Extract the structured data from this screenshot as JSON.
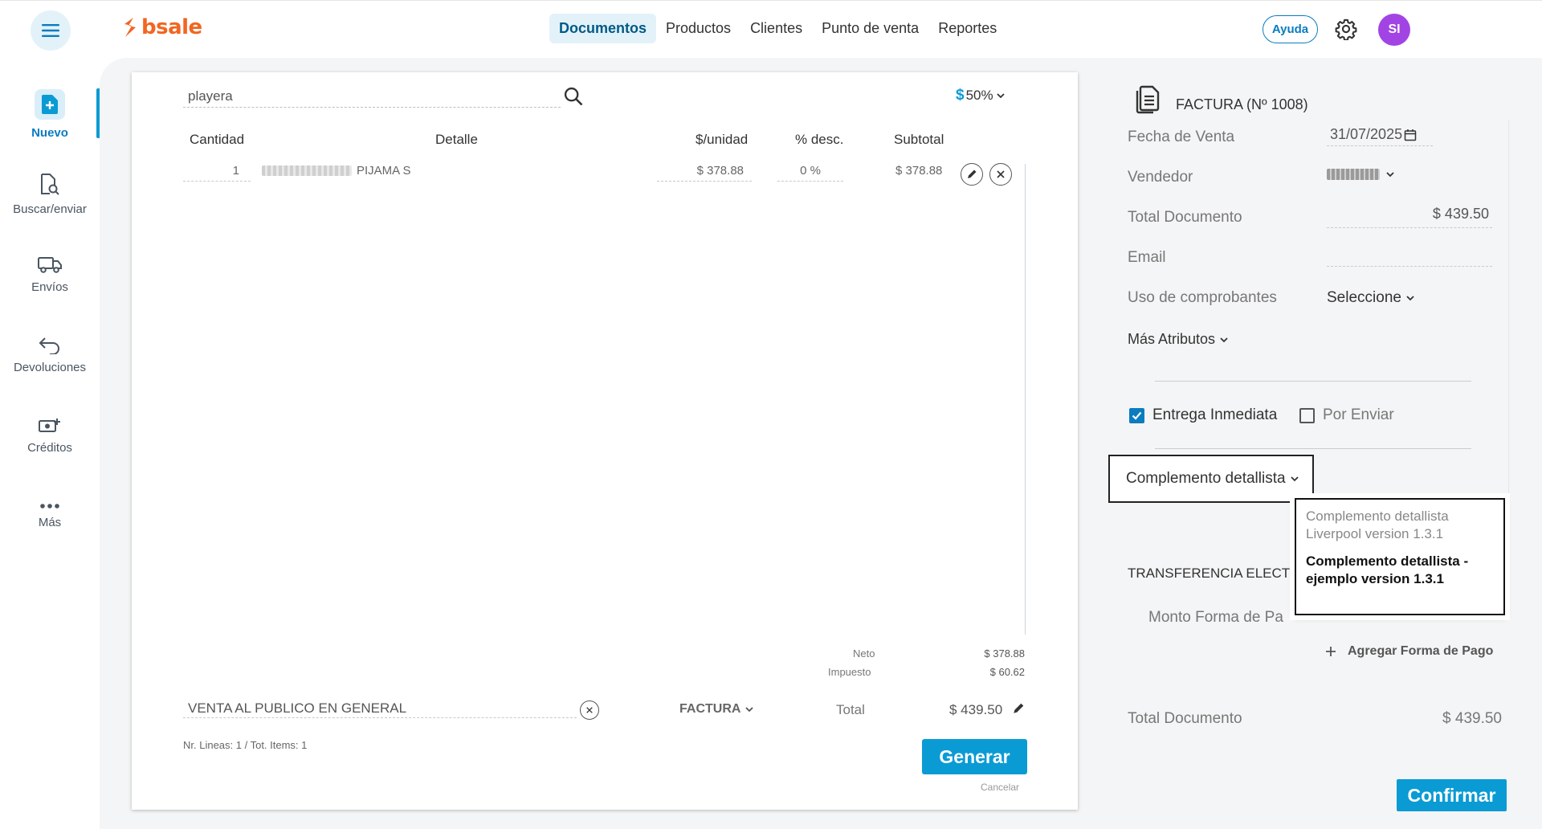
{
  "topbar": {
    "logo_text": "bsale",
    "nav": [
      {
        "label": "Documentos",
        "active": true
      },
      {
        "label": "Productos",
        "active": false
      },
      {
        "label": "Clientes",
        "active": false
      },
      {
        "label": "Punto de venta",
        "active": false
      },
      {
        "label": "Reportes",
        "active": false
      }
    ],
    "help_label": "Ayuda",
    "avatar_initials": "SI"
  },
  "sidebar": {
    "items": [
      {
        "label": "Nuevo",
        "icon": "new-document-icon",
        "active": true
      },
      {
        "label": "Buscar/enviar",
        "icon": "search-document-icon",
        "active": false
      },
      {
        "label": "Envíos",
        "icon": "truck-icon",
        "active": false
      },
      {
        "label": "Devoluciones",
        "icon": "return-arrow-icon",
        "active": false
      },
      {
        "label": "Créditos",
        "icon": "cash-plus-icon",
        "active": false
      },
      {
        "label": "Más",
        "icon": "more-dots-icon",
        "active": false
      }
    ]
  },
  "document": {
    "search_value": "playera",
    "discount_currency": "$",
    "discount_value": "50%",
    "headers": {
      "qty": "Cantidad",
      "detail": "Detalle",
      "unit_price": "$/unidad",
      "discount": "% desc.",
      "subtotal": "Subtotal"
    },
    "rows": [
      {
        "qty": "1",
        "detail": "PIJAMA S",
        "unit_price": "$ 378.88",
        "discount": "0 %",
        "subtotal": "$ 378.88"
      }
    ],
    "summary": {
      "neto_label": "Neto",
      "neto_value": "$ 378.88",
      "tax_label": "Impuesto",
      "tax_value": "$ 60.62"
    },
    "client": "VENTA AL PUBLICO EN GENERAL",
    "doc_type": "FACTURA",
    "total_label": "Total",
    "total_value": "$ 439.50",
    "lines_info": "Nr. Lineas: 1 / Tot. Items: 1",
    "generate_label": "Generar",
    "cancel_label": "Cancelar"
  },
  "right_panel": {
    "title": "FACTURA (Nº 1008)",
    "fecha_label": "Fecha de Venta",
    "fecha_value": "31/07/2025",
    "vendedor_label": "Vendedor",
    "total_doc_label": "Total Documento",
    "total_doc_value": "$ 439.50",
    "email_label": "Email",
    "uso_label": "Uso de comprobantes",
    "uso_value": "Seleccione",
    "mas_atributos": "Más Atributos",
    "entrega_inmediata": "Entrega Inmediata",
    "entrega_checked": true,
    "por_enviar": "Por Enviar",
    "por_enviar_checked": false,
    "complemento_label": "Complemento detallista",
    "dropdown_options": [
      "Complemento detallista Liverpool version 1.3.1",
      "Complemento detallista - ejemplo version 1.3.1"
    ],
    "transferencia_label": "TRANSFERENCIA ELECTR",
    "monto_label": "Monto Forma de Pa",
    "add_payment_label": "Agregar Forma de Pago",
    "total_doc_bottom_label": "Total Documento",
    "total_doc_bottom_value": "$ 439.50",
    "confirm_label": "Confirmar"
  },
  "colors": {
    "accent": "#0a9bd4",
    "brand": "#f26522",
    "avatar": "#a244e4"
  }
}
